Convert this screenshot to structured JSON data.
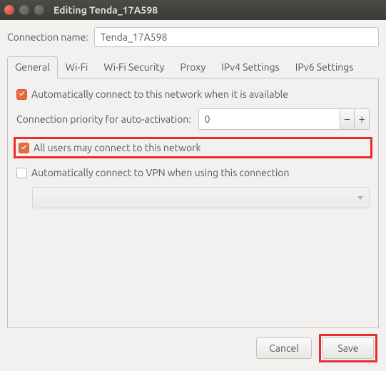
{
  "window": {
    "title": "Editing Tenda_17A598"
  },
  "connection_name": {
    "label": "Connection name:",
    "value": "Tenda_17A598"
  },
  "tabs": {
    "general": "General",
    "wifi": "Wi-Fi",
    "security": "Wi-Fi Security",
    "proxy": "Proxy",
    "ipv4": "IPv4 Settings",
    "ipv6": "IPv6 Settings"
  },
  "general": {
    "auto_connect": "Automatically connect to this network when it is available",
    "priority_label": "Connection priority for auto-activation:",
    "priority_value": "0",
    "all_users": "All users may connect to this network",
    "auto_vpn": "Automatically connect to VPN when using this connection"
  },
  "buttons": {
    "cancel": "Cancel",
    "save": "Save"
  },
  "glyphs": {
    "minus": "−",
    "plus": "+"
  }
}
